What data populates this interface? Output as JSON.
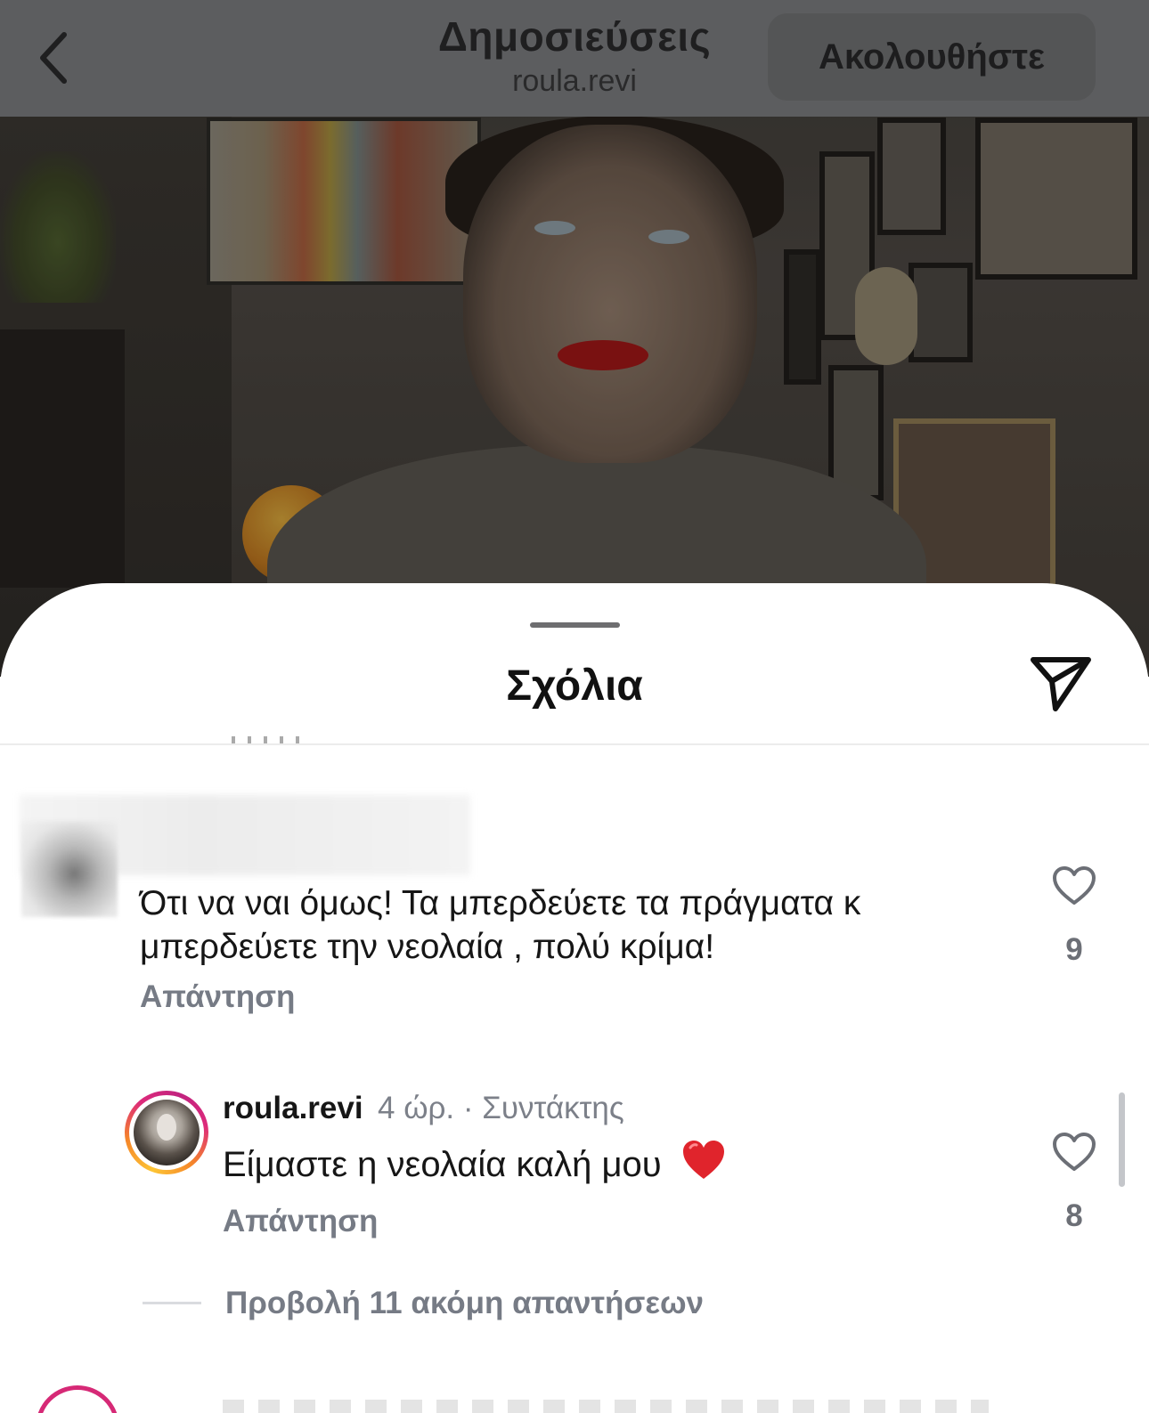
{
  "header": {
    "title": "Δημοσιεύσεις",
    "subtitle": "roula.revi",
    "follow_label": "Ακολουθήστε"
  },
  "sheet": {
    "title": "Σχόλια"
  },
  "comments": [
    {
      "text": "Ότι να ναι όμως! Τα μπερδεύετε τα πράγματα κ μπερδεύετε την νεολαία , πολύ κρίμα!",
      "reply_label": "Απάντηση",
      "likes": "9"
    },
    {
      "username": "roula.revi",
      "meta": "4 ώρ. · Συντάκτης",
      "text": "Είμαστε η νεολαία  καλή μου",
      "emoji": "red-heart",
      "reply_label": "Απάντηση",
      "likes": "8"
    }
  ],
  "view_more_replies": "Προβολή 11 ακόμη απαντήσεων",
  "colors": {
    "story_ring": [
      "#fdc535",
      "#f58529",
      "#dd2a7b"
    ],
    "secondary_text": "#767b85",
    "dim_header": "#5c5d5f"
  },
  "icons": {
    "back": "chevron-left-icon",
    "share": "send-icon",
    "like": "heart-outline-icon"
  }
}
